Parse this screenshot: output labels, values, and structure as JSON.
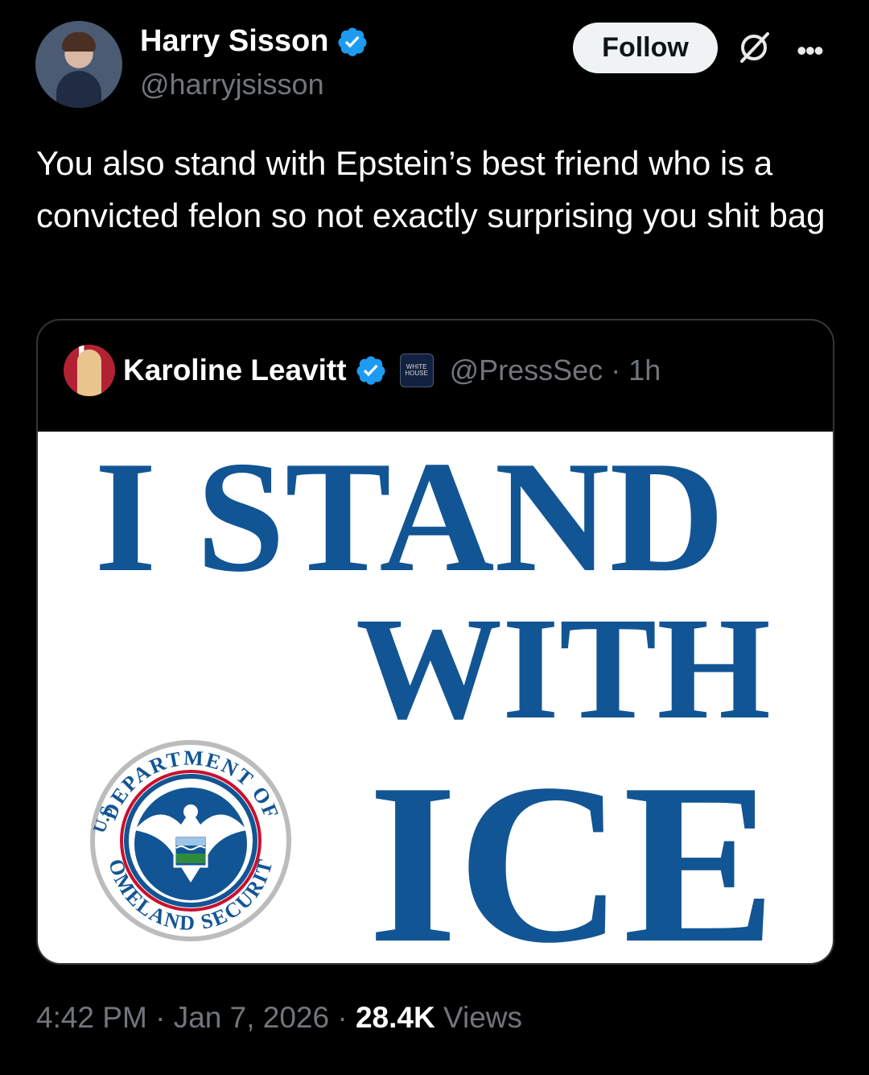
{
  "author": {
    "name": "Harry Sisson",
    "handle": "@harryjsisson",
    "follow_label": "Follow"
  },
  "tweet": {
    "text": "You also stand with Epstein’s best friend who is a convicted felon so not exactly surprising you shit bag"
  },
  "quoted_tweet": {
    "name": "Karoline Leavitt",
    "badge_text": "WHITE HOUSE",
    "handle": "@PressSec",
    "time": "1h",
    "image": {
      "line1": "I STAND",
      "line2": "WITH",
      "line3": "ICE",
      "seal_text_top": "DEPARTMENT OF",
      "seal_text_bottom": "HOMELAND SECURITY",
      "seal_text_left": "U.S."
    }
  },
  "meta": {
    "time": "4:42 PM",
    "date": "Jan 7, 2026",
    "views_count": "28.4K",
    "views_label": "Views"
  },
  "colors": {
    "background": "#000000",
    "verified": "#1d9bf0",
    "ice_blue": "#125594",
    "seal_red": "#c8102e"
  },
  "icons": [
    "verified-badge-icon",
    "grok-icon",
    "more-options-icon",
    "dhs-seal-icon"
  ]
}
